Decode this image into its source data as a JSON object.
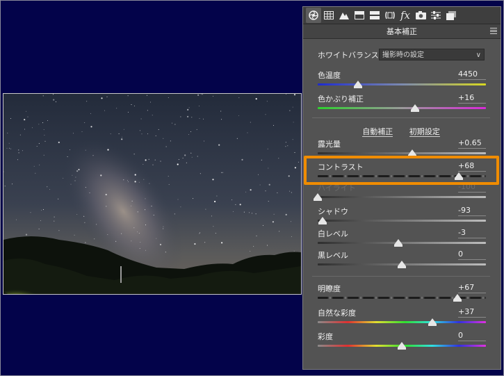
{
  "panel": {
    "header_title": "基本補正",
    "toolbar_icons": [
      "aperture-icon",
      "grid-icon",
      "mountain-icon",
      "split-toning-icon",
      "hsl-icon",
      "lens-icon",
      "fx-icon",
      "camera-icon",
      "sliders-icon",
      "presets-icon"
    ],
    "fx_label": "fx"
  },
  "white_balance": {
    "label": "ホワイトバランス：",
    "value": "撮影時の設定"
  },
  "auto_row": {
    "auto_label": "自動補正",
    "default_label": "初期設定"
  },
  "sliders": [
    {
      "id": "temperature",
      "label": "色温度",
      "value": "4450",
      "fraction": 0.24,
      "track": "temp"
    },
    {
      "id": "tint",
      "label": "色かぶり補正",
      "value": "+16",
      "fraction": 0.58,
      "track": "tint"
    },
    {
      "id": "exposure",
      "label": "露光量",
      "value": "+0.65",
      "fraction": 0.56,
      "track": "gray"
    },
    {
      "id": "contrast",
      "label": "コントラスト",
      "value": "+68",
      "fraction": 0.84,
      "track": "dark"
    },
    {
      "id": "highlights",
      "label": "ハイライト",
      "value": "-100",
      "fraction": 0.0,
      "track": "gray"
    },
    {
      "id": "shadows",
      "label": "シャドウ",
      "value": "-93",
      "fraction": 0.03,
      "track": "gray"
    },
    {
      "id": "whites",
      "label": "白レベル",
      "value": "-3",
      "fraction": 0.48,
      "track": "gray"
    },
    {
      "id": "blacks",
      "label": "黒レベル",
      "value": "0",
      "fraction": 0.5,
      "track": "gray"
    },
    {
      "id": "clarity",
      "label": "明瞭度",
      "value": "+67",
      "fraction": 0.83,
      "track": "dark"
    },
    {
      "id": "vibrance",
      "label": "自然な彩度",
      "value": "+37",
      "fraction": 0.68,
      "track": "rainbow"
    },
    {
      "id": "saturation",
      "label": "彩度",
      "value": "0",
      "fraction": 0.5,
      "track": "rainbow"
    }
  ],
  "colors": {
    "highlight_border": "#f08c00",
    "background": "#03034a",
    "panel": "#535353"
  }
}
